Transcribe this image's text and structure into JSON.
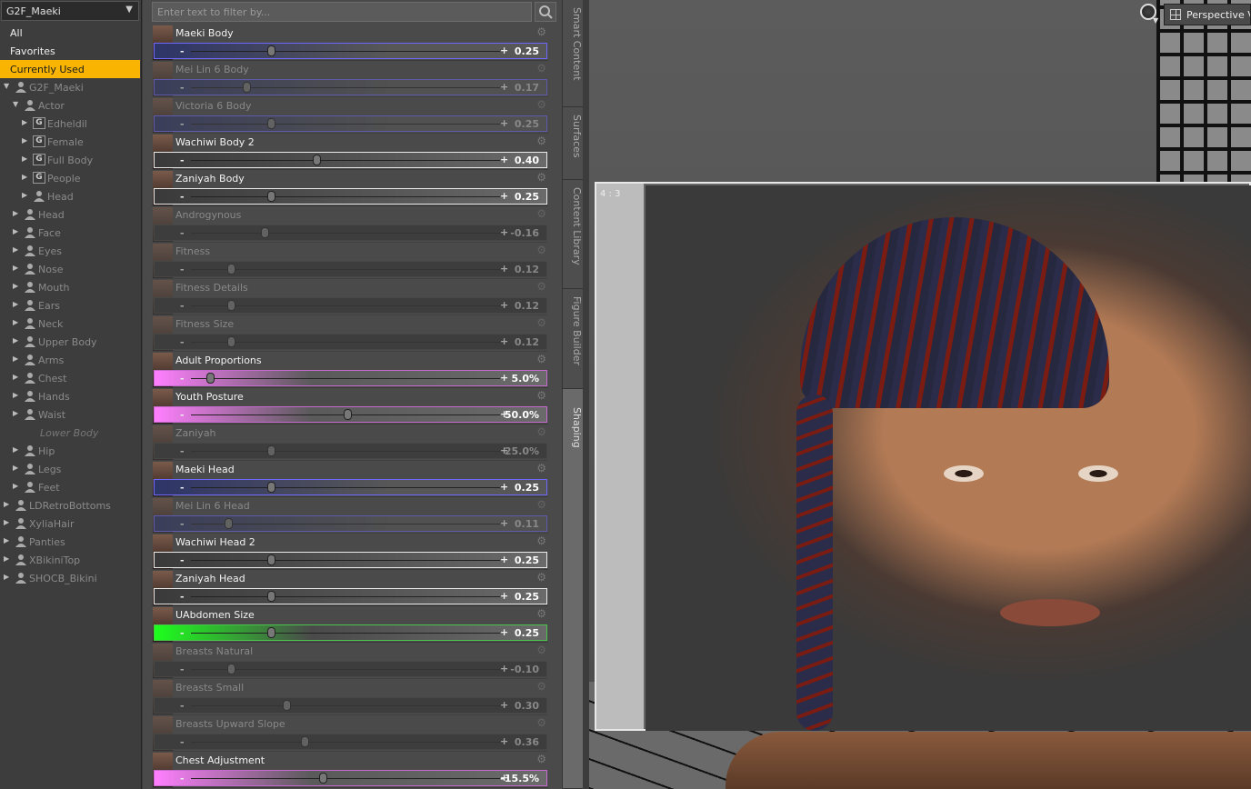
{
  "figure_selector": {
    "value": "G2F_Maeki",
    "arrow": "▼"
  },
  "left_nav": {
    "all": "All",
    "favorites": "Favorites",
    "currently_used": "Currently Used"
  },
  "tree": [
    {
      "label": "G2F_Maeki",
      "indent": 0,
      "icon": "figure",
      "expand": "open"
    },
    {
      "label": "Actor",
      "indent": 1,
      "icon": "person",
      "expand": "open"
    },
    {
      "label": "Edheldil",
      "indent": 2,
      "icon": "g",
      "expand": "closed"
    },
    {
      "label": "Female",
      "indent": 2,
      "icon": "g",
      "expand": "closed"
    },
    {
      "label": "Full Body",
      "indent": 2,
      "icon": "g",
      "expand": "closed"
    },
    {
      "label": "People",
      "indent": 2,
      "icon": "g",
      "expand": "closed"
    },
    {
      "label": "Head",
      "indent": 2,
      "icon": "person",
      "expand": "closed"
    },
    {
      "label": "Head",
      "indent": 1,
      "icon": "person",
      "expand": "closed"
    },
    {
      "label": "Face",
      "indent": 1,
      "icon": "person",
      "expand": "closed"
    },
    {
      "label": "Eyes",
      "indent": 1,
      "icon": "person",
      "expand": "closed"
    },
    {
      "label": "Nose",
      "indent": 1,
      "icon": "person",
      "expand": "closed"
    },
    {
      "label": "Mouth",
      "indent": 1,
      "icon": "person",
      "expand": "closed"
    },
    {
      "label": "Ears",
      "indent": 1,
      "icon": "person",
      "expand": "closed"
    },
    {
      "label": "Neck",
      "indent": 1,
      "icon": "person",
      "expand": "closed"
    },
    {
      "label": "Upper Body",
      "indent": 1,
      "icon": "person",
      "expand": "closed"
    },
    {
      "label": "Arms",
      "indent": 1,
      "icon": "person",
      "expand": "closed"
    },
    {
      "label": "Chest",
      "indent": 1,
      "icon": "person",
      "expand": "closed"
    },
    {
      "label": "Hands",
      "indent": 1,
      "icon": "person",
      "expand": "closed"
    },
    {
      "label": "Waist",
      "indent": 1,
      "icon": "person",
      "expand": "closed"
    },
    {
      "label": "Lower Body",
      "indent": 1,
      "icon": "none",
      "expand": "none"
    },
    {
      "label": "Hip",
      "indent": 1,
      "icon": "person",
      "expand": "closed"
    },
    {
      "label": "Legs",
      "indent": 1,
      "icon": "person",
      "expand": "closed"
    },
    {
      "label": "Feet",
      "indent": 1,
      "icon": "person",
      "expand": "closed"
    },
    {
      "label": "LDRetroBottoms",
      "indent": 0,
      "icon": "figure",
      "expand": "closed"
    },
    {
      "label": "XyliaHair",
      "indent": 0,
      "icon": "figure",
      "expand": "closed"
    },
    {
      "label": "Panties",
      "indent": 0,
      "icon": "figure",
      "expand": "closed"
    },
    {
      "label": "XBikiniTop",
      "indent": 0,
      "icon": "figure",
      "expand": "closed"
    },
    {
      "label": "SHOCB_Bikini",
      "indent": 0,
      "icon": "figure",
      "expand": "closed"
    }
  ],
  "filter": {
    "placeholder": "Enter text to filter by..."
  },
  "sliders": [
    {
      "name": "Maeki Body",
      "value": "0.25",
      "level": 0.25,
      "style": "blue",
      "faded": false
    },
    {
      "name": "Mei Lin 6 Body",
      "value": "0.17",
      "level": 0.17,
      "style": "blue",
      "faded": true
    },
    {
      "name": "Victoria 6 Body",
      "value": "0.25",
      "level": 0.25,
      "style": "blue",
      "faded": true
    },
    {
      "name": "Wachiwi Body 2",
      "value": "0.40",
      "level": 0.4,
      "style": "white",
      "faded": false
    },
    {
      "name": "Zaniyah Body",
      "value": "0.25",
      "level": 0.25,
      "style": "white",
      "faded": false
    },
    {
      "name": "Androgynous",
      "value": "-0.16",
      "level": 0.23,
      "style": "dim",
      "faded": true
    },
    {
      "name": "Fitness",
      "value": "0.12",
      "level": 0.12,
      "style": "dim",
      "faded": true
    },
    {
      "name": "Fitness Details",
      "value": "0.12",
      "level": 0.12,
      "style": "dim",
      "faded": true
    },
    {
      "name": "Fitness Size",
      "value": "0.12",
      "level": 0.12,
      "style": "dim",
      "faded": true
    },
    {
      "name": "Adult Proportions",
      "value": "5.0%",
      "level": 0.05,
      "style": "pink",
      "faded": false
    },
    {
      "name": "Youth Posture",
      "value": "50.0%",
      "level": 0.5,
      "style": "pink",
      "faded": false
    },
    {
      "name": "Zaniyah",
      "value": "25.0%",
      "level": 0.25,
      "style": "dim",
      "faded": true
    },
    {
      "name": "Maeki Head",
      "value": "0.25",
      "level": 0.25,
      "style": "blue",
      "faded": false
    },
    {
      "name": "Mei Lin 6 Head",
      "value": "0.11",
      "level": 0.11,
      "style": "blue",
      "faded": true
    },
    {
      "name": "Wachiwi Head 2",
      "value": "0.25",
      "level": 0.25,
      "style": "white",
      "faded": false
    },
    {
      "name": "Zaniyah Head",
      "value": "0.25",
      "level": 0.25,
      "style": "white",
      "faded": false
    },
    {
      "name": "UAbdomen Size",
      "value": "0.25",
      "level": 0.25,
      "style": "green",
      "faded": false
    },
    {
      "name": "Breasts Natural",
      "value": "-0.10",
      "level": 0.12,
      "style": "dim",
      "faded": true
    },
    {
      "name": "Breasts Small",
      "value": "0.30",
      "level": 0.3,
      "style": "dim",
      "faded": true
    },
    {
      "name": "Breasts Upward Slope",
      "value": "0.36",
      "level": 0.36,
      "style": "dim",
      "faded": true
    },
    {
      "name": "Chest Adjustment",
      "value": "-15.5%",
      "level": 0.42,
      "style": "pink",
      "faded": false
    }
  ],
  "side_tabs": [
    "Smart Content",
    "Surfaces",
    "Content Library",
    "Figure Builder",
    "Shaping"
  ],
  "viewport": {
    "camera_label": "Perspective View",
    "aspect_label": "4 : 3"
  }
}
